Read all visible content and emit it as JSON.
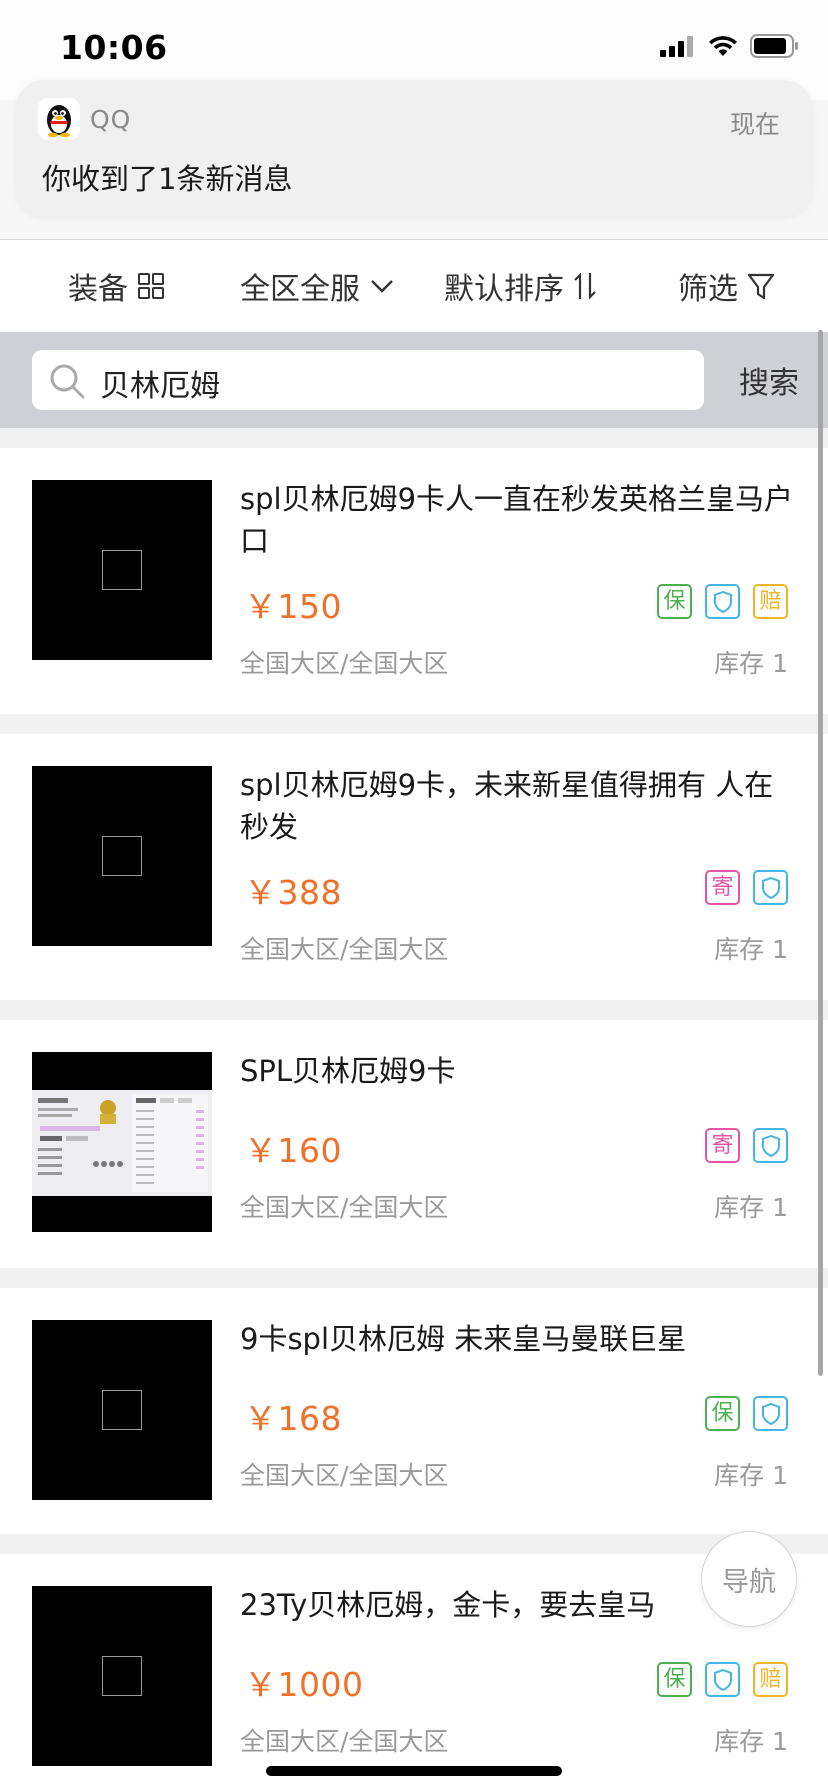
{
  "status_bar": {
    "time": "10:06"
  },
  "notification": {
    "app_name": "QQ",
    "time": "现在",
    "message": "你收到了1条新消息"
  },
  "filters": {
    "equipment": "装备",
    "region": "全区全服",
    "sort": "默认排序",
    "filter": "筛选"
  },
  "search": {
    "query": "贝林厄姆",
    "button": "搜索"
  },
  "colors": {
    "price": "#f0722a",
    "badge_green": "#4caf50",
    "badge_blue": "#45b4e6",
    "badge_yellow": "#f0b429",
    "badge_pink": "#e455a8"
  },
  "items": [
    {
      "title": "spl贝林厄姆9卡人一直在秒发英格兰皇马户口",
      "price": "￥150",
      "region": "全国大区/全国大区",
      "stock": "库存 1",
      "badges": [
        "保",
        "shield",
        "赔"
      ]
    },
    {
      "title": "spl贝林厄姆9卡，未来新星值得拥有 人在秒发",
      "price": "￥388",
      "region": "全国大区/全国大区",
      "stock": "库存 1",
      "badges": [
        "寄",
        "shield"
      ]
    },
    {
      "title": "SPL贝林厄姆9卡",
      "price": "￥160",
      "region": "全国大区/全国大区",
      "stock": "库存 1",
      "badges": [
        "寄",
        "shield"
      ]
    },
    {
      "title": "9卡spl贝林厄姆 未来皇马曼联巨星",
      "price": "￥168",
      "region": "全国大区/全国大区",
      "stock": "库存 1",
      "badges": [
        "保",
        "shield"
      ]
    },
    {
      "title": "23Ty贝林厄姆，金卡，要去皇马",
      "price": "￥1000",
      "region": "全国大区/全国大区",
      "stock": "库存 1",
      "badges": [
        "保",
        "shield",
        "赔"
      ]
    }
  ],
  "nav_button": "导航"
}
